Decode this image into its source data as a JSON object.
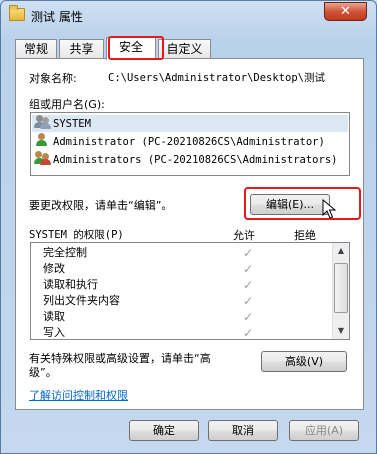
{
  "window": {
    "title": "测试 属性",
    "close_glyph": "✕"
  },
  "tabs": [
    {
      "label": "常规"
    },
    {
      "label": "共享"
    },
    {
      "label": "安全"
    },
    {
      "label": "自定义"
    }
  ],
  "security": {
    "object_label": "对象名称:",
    "object_value": "C:\\Users\\Administrator\\Desktop\\测试",
    "groups_label": "组或用户名(G):",
    "users": [
      {
        "name": "SYSTEM",
        "icon": "system-users-icon"
      },
      {
        "name": "Administrator (PC-20210826CS\\Administrator)",
        "icon": "user-icon"
      },
      {
        "name": "Administrators (PC-20210826CS\\Administrators)",
        "icon": "users-group-icon"
      }
    ],
    "change_perm_text": "要更改权限，请单击“编辑”。",
    "edit_button": "编辑(E)...",
    "perm_header": "SYSTEM 的权限(P)",
    "allow_header": "允许",
    "deny_header": "拒绝",
    "permissions": [
      {
        "name": "完全控制",
        "allow": "✓"
      },
      {
        "name": "修改",
        "allow": "✓"
      },
      {
        "name": "读取和执行",
        "allow": "✓"
      },
      {
        "name": "列出文件夹内容",
        "allow": "✓"
      },
      {
        "name": "读取",
        "allow": "✓"
      },
      {
        "name": "写入",
        "allow": "✓"
      }
    ],
    "special_text_1": "有关特殊权限或高级设置，请单击“高",
    "special_text_2": "级”。",
    "advanced_button": "高级(V)",
    "learn_link": "了解访问控制和权限"
  },
  "footer": {
    "ok": "确定",
    "cancel": "取消",
    "apply": "应用(A)"
  },
  "highlight_color": "#e81919"
}
